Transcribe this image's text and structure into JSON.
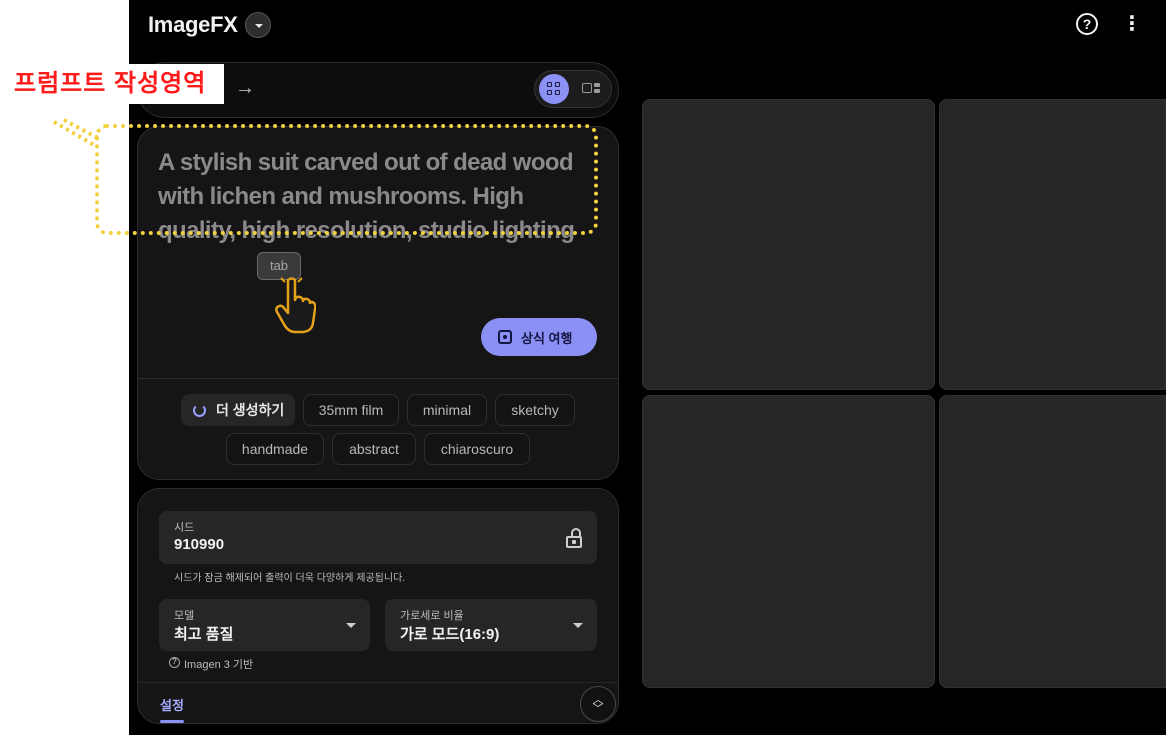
{
  "header": {
    "brand": "ImageFX"
  },
  "annotation": {
    "label": "프럼프트 작성영역",
    "color": "#ff1a1a",
    "box_color": "#f4d03f"
  },
  "prompt": {
    "text": "A stylish suit carved out of dead wood with lichen and mushrooms. High quality, high resolution, studio lighting",
    "tab_hint": "tab",
    "surprise_label": "상식 여행"
  },
  "chips": {
    "regenerate": "더 생성하기",
    "items": [
      "35mm film",
      "minimal",
      "sketchy",
      "handmade",
      "abstract",
      "chiaroscuro"
    ]
  },
  "settings": {
    "seed": {
      "label": "시드",
      "value": "910990",
      "hint": "시드가 잠금 해제되어 출력이 더욱 다양하게 제공됩니다."
    },
    "model": {
      "label": "모델",
      "value": "최고 품질",
      "note": "Imagen 3 기반"
    },
    "aspect": {
      "label": "가로세로 비율",
      "value": "가로 모드(16:9)"
    },
    "tab_label": "설정"
  },
  "colors": {
    "accent": "#8b90f4",
    "background": "#000000",
    "card": "#151515",
    "tile": "#262626"
  },
  "icons": [
    "help-icon",
    "more-vert-icon",
    "arrow-right-icon",
    "grid-view-icon",
    "list-view-icon",
    "hand-cursor-icon",
    "dice-icon",
    "refresh-icon",
    "unlock-icon",
    "chevron-down-icon",
    "help-circle-icon",
    "expand-icon"
  ]
}
